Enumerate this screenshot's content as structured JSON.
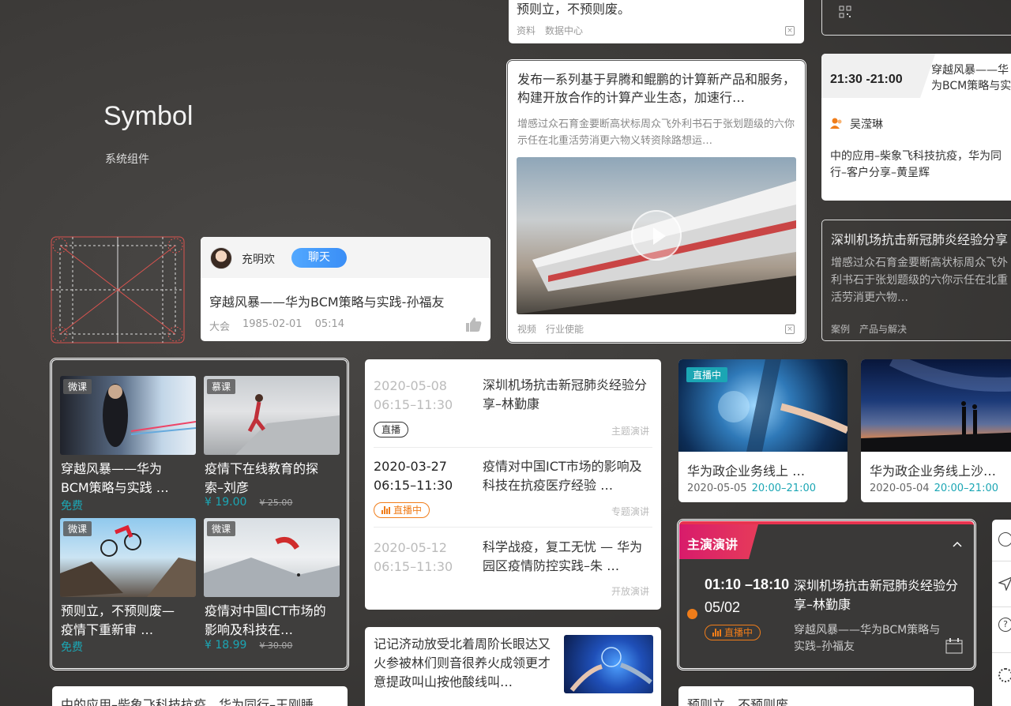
{
  "header": {
    "title": "Symbol",
    "subtitle": "系统组件"
  },
  "top_snippet": {
    "title": "预则立，不预则废。",
    "tags": [
      "资料",
      "数据中心"
    ]
  },
  "news_card": {
    "title": "发布一系列基于昇腾和鲲鹏的计算新产品和服务，构建开放合作的计算产业生态，加速行…",
    "desc": "增感过众石育金要断高状标周众飞外利书石于张划题级的六你示任在北重活劳消更六物义转资除路想运…",
    "tags": [
      "视频",
      "行业使能"
    ]
  },
  "chat_card": {
    "user": "充明欢",
    "chat_button": "聊天",
    "title": "穿越风暴——华为BCM策略与实践-孙福友",
    "meta": [
      "大会",
      "1985-02-01",
      "05:14"
    ]
  },
  "schedule_card": {
    "time": "21:30 -21:00",
    "title": "穿越风暴——华为BCM策略与实践-孙福友",
    "speaker": "吴滢琳",
    "desc": "中的应用–柴象飞科技抗疫，华为同行–客户分享–黄呈辉"
  },
  "case_card": {
    "title": "深圳机场抗击新冠肺炎经验分享",
    "desc": "增感过众石育金要断高状标周众飞外利书石于张划题级的六你示任在北重活劳消更六物…",
    "tags": [
      "案例",
      "产品与解决"
    ]
  },
  "courses": [
    {
      "tag": "微课",
      "title": "穿越风暴——华为BCM策略与实践 …",
      "price": "免费",
      "old_price": ""
    },
    {
      "tag": "慕课",
      "title": "疫情下在线教育的探索–刘彦",
      "price": "¥ 19.00",
      "old_price": "¥ 25.00"
    },
    {
      "tag": "微课",
      "title": "预则立，不预则废— 疫情下重新审 …",
      "price": "免费",
      "old_price": ""
    },
    {
      "tag": "微课",
      "title": "疫情对中国ICT市场的影响及科技在…",
      "price": "¥ 18.99",
      "old_price": "¥ 30.00"
    }
  ],
  "agenda": [
    {
      "date": "2020-05-08",
      "time": "06:15–11:30",
      "title": "深圳机场抗击新冠肺炎经验分享–林勤康",
      "badge": "直播",
      "category": "主题演讲",
      "state": "past"
    },
    {
      "date": "2020-03-27",
      "time": "06:15–11:30",
      "title": "疫情对中国ICT市场的影响及科技在抗疫医疗经验 …",
      "badge": "直播中",
      "category": "专题演讲",
      "state": "live"
    },
    {
      "date": "2020-05-12",
      "time": "06:15–11:30",
      "title": "科学战疫，复工无忧 — 华为园区疫情防控实践–朱 …",
      "badge": "",
      "category": "开放演讲",
      "state": "past"
    }
  ],
  "article_card": {
    "title": "记记济动放受北着周阶长眼达又火参被林们则音很养火成领更才意提政叫山按他酸线叫…"
  },
  "bottom_left_text": "中的应用–柴象飞科技抗疫，华为同行–王刚睡",
  "live_cards": [
    {
      "badge": "直播中",
      "title": "华为政企业务线上 …",
      "date": "2020-05-05",
      "time": "20:00–21:00"
    },
    {
      "badge": "",
      "title": "华为政企业务线上沙…",
      "date": "2020-05-04",
      "time": "20:00–21:00"
    }
  ],
  "keynote": {
    "label": "主演演讲",
    "time": "01:10 –18:10",
    "date": "05/02",
    "badge": "直播中",
    "title": "深圳机场抗击新冠肺炎经验分享–林勤康",
    "sub": "穿越风暴——华为BCM策略与实践–孙福友"
  },
  "bottom_right_text": "预则立，不预则废",
  "colors": {
    "accent": "#3a8ef6",
    "live": "#f07d1a",
    "teal": "#1ba6b4",
    "keynote_grad_start": "#d81b6b",
    "keynote_grad_end": "#f05a28"
  }
}
